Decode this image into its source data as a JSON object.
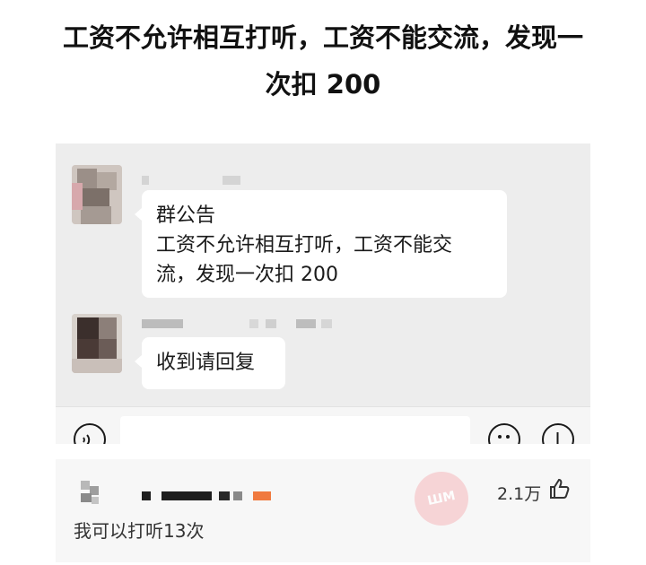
{
  "headline": {
    "line1": "工资不允许相互打听，工资不能交流，发现一",
    "line2": "次扣 200"
  },
  "chat": {
    "message1": {
      "line1": "群公告",
      "line2": "工资不允许相互打听，工资不能交",
      "line3": "流，发现一次扣 200"
    },
    "message2": {
      "text": "收到请回复"
    },
    "icons": [
      "voice-icon",
      "emoji-icon",
      "add-icon"
    ]
  },
  "comment": {
    "like_count": "2.1万",
    "text": "我可以打听13次",
    "icons": [
      "thumbs-up-icon"
    ],
    "colors": {
      "accent": "#f07a3f",
      "stamp": "#f6c9cc"
    }
  }
}
